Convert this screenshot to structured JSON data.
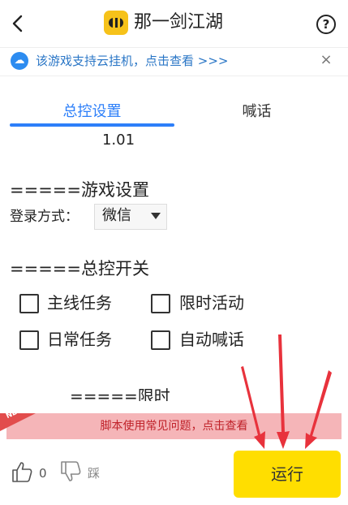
{
  "header": {
    "back_icon": "chevron-left-icon",
    "app_icon": "bee-app-icon",
    "title": "那一剑江湖",
    "help_label": "?"
  },
  "notice": {
    "icon": "cloud-icon",
    "text": "该游戏支持云挂机，点击查看 >>>",
    "close_label": "×"
  },
  "tabs": [
    {
      "label": "总控设置",
      "active": true
    },
    {
      "label": "喊话",
      "active": false
    }
  ],
  "version": "1.01",
  "game_settings": {
    "title": "=====游戏设置",
    "login_label": "登录方式：",
    "login_value": "微信"
  },
  "control": {
    "title": "=====总控开关",
    "options": [
      {
        "label": "主线任务",
        "checked": false
      },
      {
        "label": "限时活动",
        "checked": false
      },
      {
        "label": "日常任务",
        "checked": false
      },
      {
        "label": "自动喊话",
        "checked": false
      }
    ],
    "partial_heading": "=====限时活动"
  },
  "faq": {
    "badge": "NEW",
    "text": "脚本使用常见问题，点击查看"
  },
  "footer": {
    "like_count": "0",
    "dislike_label": "踩",
    "run_label": "运行"
  },
  "colors": {
    "accent": "#2d7ff9",
    "run_button": "#ffde00",
    "faq_background": "#f5b5b8",
    "faq_text": "#c0222a",
    "arrow": "#e8323c"
  }
}
